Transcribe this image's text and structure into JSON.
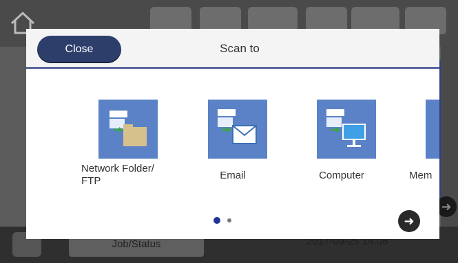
{
  "background": {
    "job_status_label": "Job/Status",
    "datetime": "2017-09-25 14:08"
  },
  "dialog": {
    "close_label": "Close",
    "title": "Scan to",
    "options": [
      {
        "label": "Network Folder/\nFTP",
        "icon": "network-folder-icon"
      },
      {
        "label": "Email",
        "icon": "email-icon"
      },
      {
        "label": "Computer",
        "icon": "computer-icon"
      },
      {
        "label": "Mem",
        "icon": "memory-device-icon"
      }
    ],
    "pager": {
      "current_page": 1,
      "total_pages": 2
    }
  },
  "colors": {
    "accent": "#2d3e6b",
    "tile": "#5b82c6",
    "header_rule": "#2e3a87"
  }
}
